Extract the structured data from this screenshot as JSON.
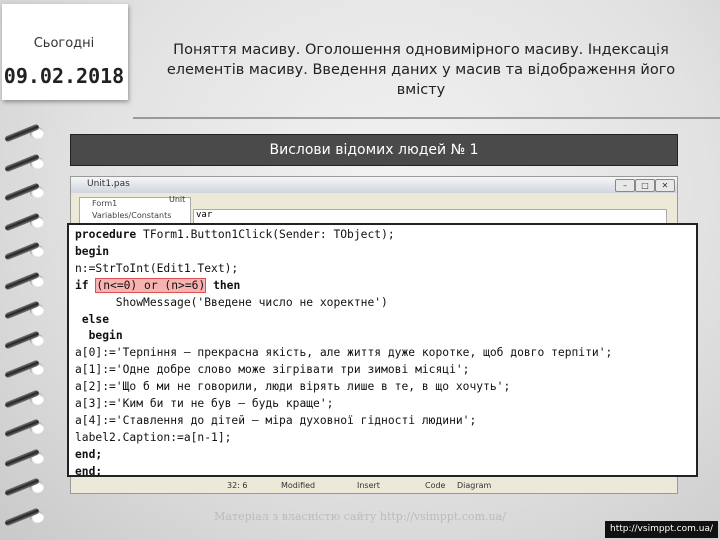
{
  "header": {
    "today_label": "Сьогодні",
    "date": "09.02.2018",
    "title": "Поняття масиву. Оголошення одновимірного масиву. Індексація елементів масиву. Введення даних у масив та відображення його вмісту"
  },
  "banner": {
    "text": "Вислови відомих людей № 1"
  },
  "ide": {
    "window_title": "Unit1.pas",
    "tree_items": [
      "Form1",
      "Variables/Constants"
    ],
    "tab_label": "Unit",
    "editor_top": "var",
    "status": {
      "position": "32: 6",
      "modified": "Modified",
      "mode": "Insert",
      "tab_code": "Code",
      "tab_diagram": "Diagram"
    }
  },
  "code": {
    "l1_kw": "procedure",
    "l1_rest": " TForm1.Button1Click(Sender: TObject);",
    "l2_kw": "begin",
    "l3": "n:=StrToInt(Edit1.Text);",
    "l4_kw1": "if",
    "l4_cond": "(n<=0) or (n>=6)",
    "l4_kw2": "then",
    "l5": "      ShowMessage('Введене число не хоректне')",
    "l6_kw": "else",
    "l7_kw": "begin",
    "l8": "a[0]:='Терпіння — прекрасна якість, але життя дуже коротке, щоб довго терпіти';",
    "l9": "a[1]:='Одне добре слово може зігрівати три зимові місяці';",
    "l10": "a[2]:='Що б ми не говорили, люди вірять лише в те, в що хочуть';",
    "l11": "a[3]:='Ким би ти не був — будь краще';",
    "l12": "a[4]:='Ставлення до дітей — міра духовної гідності людини';",
    "l13": "label2.Caption:=a[n-1];",
    "l14_kw": "end;",
    "l15_kw": "end;"
  },
  "footer": {
    "watermark": "Матеріал з власністю сайту http://vsimppt.com.ua/",
    "url": "http://vsimppt.com.ua/"
  }
}
